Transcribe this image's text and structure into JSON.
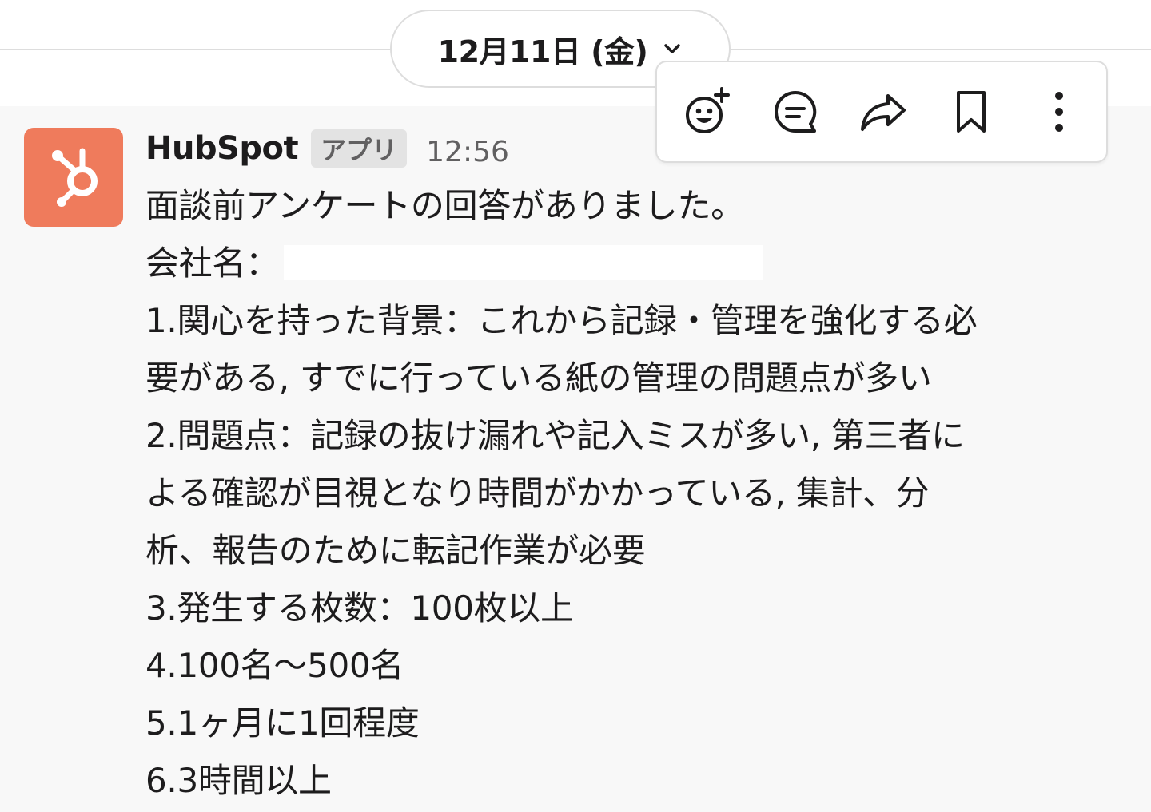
{
  "date_divider": {
    "label": "12月11日 (金)"
  },
  "message_actions": [
    {
      "name": "add-reaction",
      "icon": "emoji-add-icon"
    },
    {
      "name": "reply-in-thread",
      "icon": "thread-reply-icon"
    },
    {
      "name": "share-message",
      "icon": "share-arrow-icon"
    },
    {
      "name": "save-for-later",
      "icon": "bookmark-icon"
    },
    {
      "name": "more-actions",
      "icon": "vertical-dots-icon"
    }
  ],
  "message": {
    "sender": "HubSpot",
    "badge": "アプリ",
    "time": "12:56",
    "avatar_icon": "hubspot-logo",
    "lines": {
      "l0": "面談前アンケートの回答がありました。",
      "l1": "会社名：",
      "l2": "1.関心を持った背景：これから記録・管理を強化する必",
      "l3": "要がある, すでに行っている紙の管理の問題点が多い",
      "l4": "2.問題点：記録の抜け漏れや記入ミスが多い, 第三者に",
      "l5": "よる確認が目視となり時間がかかっている, 集計、分",
      "l6": "析、報告のために転記作業が必要",
      "l7": "3.発生する枚数：100枚以上",
      "l8": "4.100名〜500名",
      "l9": "5.1ヶ月に1回程度",
      "l10": "6.3時間以上"
    }
  },
  "colors": {
    "avatar_bg": "#ef7b5c",
    "message_bg": "#f8f8f8",
    "text": "#1d1c1d",
    "muted": "#616061",
    "border": "#dddddd"
  }
}
